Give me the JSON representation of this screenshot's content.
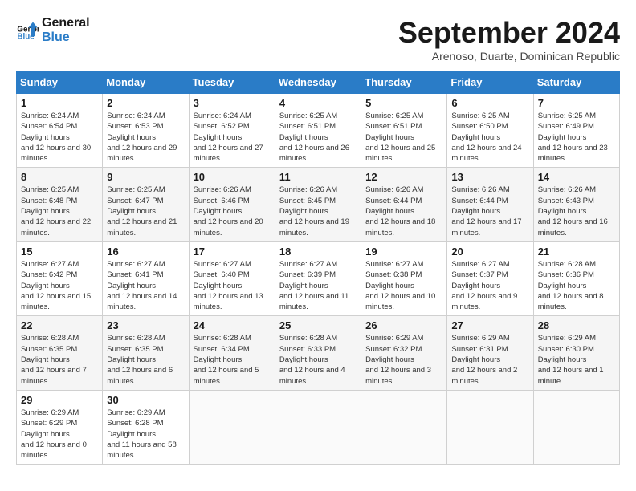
{
  "header": {
    "logo_line1": "General",
    "logo_line2": "Blue",
    "month_title": "September 2024",
    "subtitle": "Arenoso, Duarte, Dominican Republic"
  },
  "weekdays": [
    "Sunday",
    "Monday",
    "Tuesday",
    "Wednesday",
    "Thursday",
    "Friday",
    "Saturday"
  ],
  "weeks": [
    [
      {
        "day": "1",
        "sunrise": "6:24 AM",
        "sunset": "6:54 PM",
        "daylight": "12 hours and 30 minutes."
      },
      {
        "day": "2",
        "sunrise": "6:24 AM",
        "sunset": "6:53 PM",
        "daylight": "12 hours and 29 minutes."
      },
      {
        "day": "3",
        "sunrise": "6:24 AM",
        "sunset": "6:52 PM",
        "daylight": "12 hours and 27 minutes."
      },
      {
        "day": "4",
        "sunrise": "6:25 AM",
        "sunset": "6:51 PM",
        "daylight": "12 hours and 26 minutes."
      },
      {
        "day": "5",
        "sunrise": "6:25 AM",
        "sunset": "6:51 PM",
        "daylight": "12 hours and 25 minutes."
      },
      {
        "day": "6",
        "sunrise": "6:25 AM",
        "sunset": "6:50 PM",
        "daylight": "12 hours and 24 minutes."
      },
      {
        "day": "7",
        "sunrise": "6:25 AM",
        "sunset": "6:49 PM",
        "daylight": "12 hours and 23 minutes."
      }
    ],
    [
      {
        "day": "8",
        "sunrise": "6:25 AM",
        "sunset": "6:48 PM",
        "daylight": "12 hours and 22 minutes."
      },
      {
        "day": "9",
        "sunrise": "6:25 AM",
        "sunset": "6:47 PM",
        "daylight": "12 hours and 21 minutes."
      },
      {
        "day": "10",
        "sunrise": "6:26 AM",
        "sunset": "6:46 PM",
        "daylight": "12 hours and 20 minutes."
      },
      {
        "day": "11",
        "sunrise": "6:26 AM",
        "sunset": "6:45 PM",
        "daylight": "12 hours and 19 minutes."
      },
      {
        "day": "12",
        "sunrise": "6:26 AM",
        "sunset": "6:44 PM",
        "daylight": "12 hours and 18 minutes."
      },
      {
        "day": "13",
        "sunrise": "6:26 AM",
        "sunset": "6:44 PM",
        "daylight": "12 hours and 17 minutes."
      },
      {
        "day": "14",
        "sunrise": "6:26 AM",
        "sunset": "6:43 PM",
        "daylight": "12 hours and 16 minutes."
      }
    ],
    [
      {
        "day": "15",
        "sunrise": "6:27 AM",
        "sunset": "6:42 PM",
        "daylight": "12 hours and 15 minutes."
      },
      {
        "day": "16",
        "sunrise": "6:27 AM",
        "sunset": "6:41 PM",
        "daylight": "12 hours and 14 minutes."
      },
      {
        "day": "17",
        "sunrise": "6:27 AM",
        "sunset": "6:40 PM",
        "daylight": "12 hours and 13 minutes."
      },
      {
        "day": "18",
        "sunrise": "6:27 AM",
        "sunset": "6:39 PM",
        "daylight": "12 hours and 11 minutes."
      },
      {
        "day": "19",
        "sunrise": "6:27 AM",
        "sunset": "6:38 PM",
        "daylight": "12 hours and 10 minutes."
      },
      {
        "day": "20",
        "sunrise": "6:27 AM",
        "sunset": "6:37 PM",
        "daylight": "12 hours and 9 minutes."
      },
      {
        "day": "21",
        "sunrise": "6:28 AM",
        "sunset": "6:36 PM",
        "daylight": "12 hours and 8 minutes."
      }
    ],
    [
      {
        "day": "22",
        "sunrise": "6:28 AM",
        "sunset": "6:35 PM",
        "daylight": "12 hours and 7 minutes."
      },
      {
        "day": "23",
        "sunrise": "6:28 AM",
        "sunset": "6:35 PM",
        "daylight": "12 hours and 6 minutes."
      },
      {
        "day": "24",
        "sunrise": "6:28 AM",
        "sunset": "6:34 PM",
        "daylight": "12 hours and 5 minutes."
      },
      {
        "day": "25",
        "sunrise": "6:28 AM",
        "sunset": "6:33 PM",
        "daylight": "12 hours and 4 minutes."
      },
      {
        "day": "26",
        "sunrise": "6:29 AM",
        "sunset": "6:32 PM",
        "daylight": "12 hours and 3 minutes."
      },
      {
        "day": "27",
        "sunrise": "6:29 AM",
        "sunset": "6:31 PM",
        "daylight": "12 hours and 2 minutes."
      },
      {
        "day": "28",
        "sunrise": "6:29 AM",
        "sunset": "6:30 PM",
        "daylight": "12 hours and 1 minute."
      }
    ],
    [
      {
        "day": "29",
        "sunrise": "6:29 AM",
        "sunset": "6:29 PM",
        "daylight": "12 hours and 0 minutes."
      },
      {
        "day": "30",
        "sunrise": "6:29 AM",
        "sunset": "6:28 PM",
        "daylight": "11 hours and 58 minutes."
      },
      null,
      null,
      null,
      null,
      null
    ]
  ]
}
